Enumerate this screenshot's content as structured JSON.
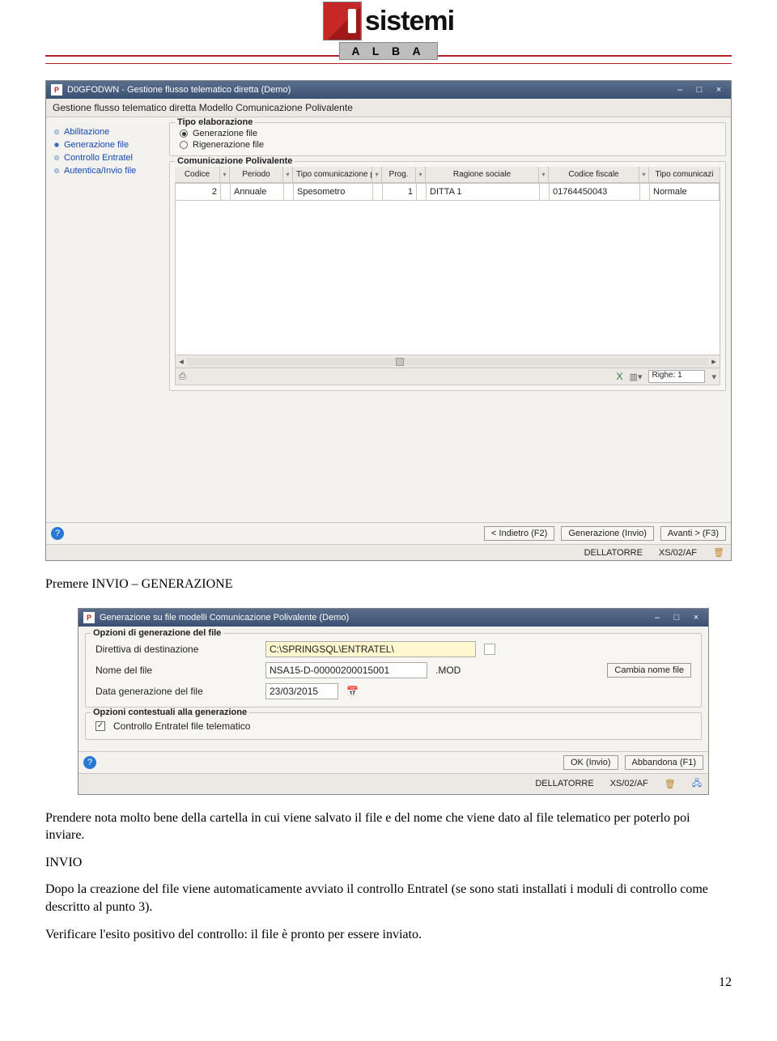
{
  "logo": {
    "text": "sistemi",
    "sub": "A L B A"
  },
  "win1": {
    "title": "D0GFODWN - Gestione flusso telematico diretta (Demo)",
    "subtitle": "Gestione flusso telematico diretta Modello Comunicazione Polivalente",
    "nav": [
      {
        "label": "Abilitazione",
        "active": false
      },
      {
        "label": "Generazione file",
        "active": true
      },
      {
        "label": "Controllo Entratel",
        "active": false
      },
      {
        "label": "Autentica/Invio file",
        "active": false
      }
    ],
    "tipo_elab": {
      "legend": "Tipo elaborazione",
      "opt1": "Generazione file",
      "opt2": "Rigenerazione file"
    },
    "com_poli": {
      "legend": "Comunicazione Polivalente",
      "cols": [
        "Codice",
        "Periodo",
        "Tipo comunicazione periodica",
        "Prog.",
        "Ragione sociale",
        "Codice fiscale",
        "Tipo comunicazi"
      ],
      "row": [
        "2",
        "Annuale",
        "Spesometro",
        "1",
        "DITTA 1",
        "01764450043",
        "Normale"
      ]
    },
    "righe_label": "Righe: 1",
    "buttons": {
      "back": "< Indietro (F2)",
      "gen": "Generazione (Invio)",
      "next": "Avanti > (F3)"
    },
    "status": {
      "user": "DELLATORRE",
      "code": "XS/02/AF"
    }
  },
  "text1": "Premere INVIO – GENERAZIONE",
  "win2": {
    "title": "Generazione su file modelli Comunicazione Polivalente (Demo)",
    "fs1": {
      "legend": "Opzioni di generazione del file",
      "row1_label": "Direttiva di destinazione",
      "row1_value": "C:\\SPRINGSQL\\ENTRATEL\\",
      "row2_label": "Nome del file",
      "row2_value": "NSA15-D-00000200015001",
      "row2_ext": ".MOD",
      "row2_btn": "Cambia nome file",
      "row3_label": "Data generazione del file",
      "row3_value": "23/03/2015"
    },
    "fs2": {
      "legend": "Opzioni contestuali alla generazione",
      "chk_label": "Controllo Entratel file telematico"
    },
    "buttons": {
      "ok": "OK (Invio)",
      "cancel": "Abbandona (F1)"
    },
    "status": {
      "user": "DELLATORRE",
      "code": "XS/02/AF"
    }
  },
  "para1": "Prendere nota molto bene della cartella in cui viene salvato il file e del nome che viene dato al file telematico per poterlo poi inviare.",
  "para2_head": "INVIO",
  "para2": "Dopo la creazione del file viene automaticamente avviato il controllo Entratel (se sono stati installati i moduli di controllo come descritto al punto 3).",
  "para3": "Verificare l'esito positivo del controllo: il file è pronto per essere inviato.",
  "page_number": "12"
}
